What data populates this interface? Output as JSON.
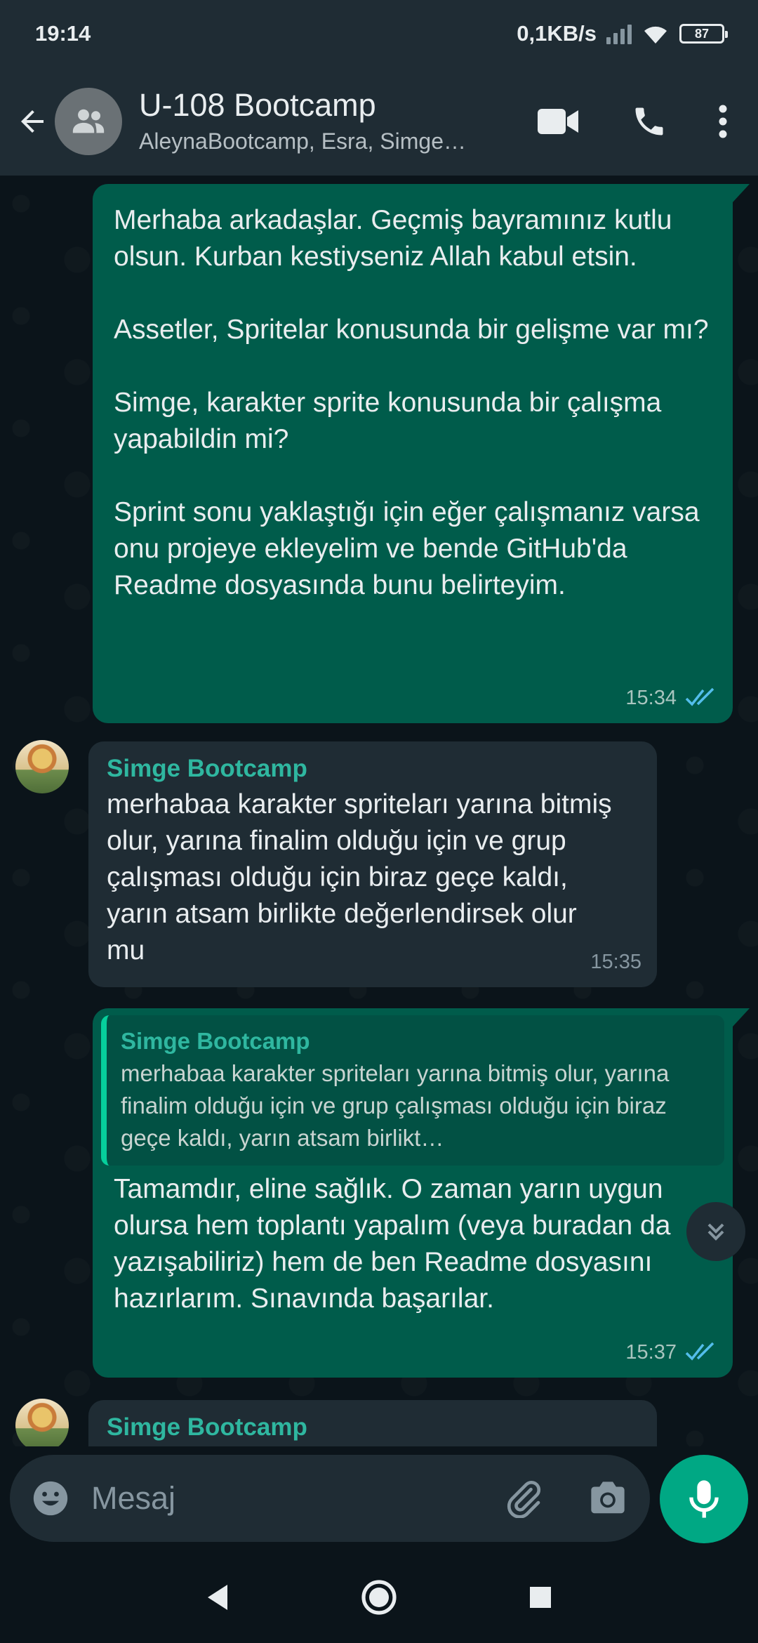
{
  "status_bar": {
    "time": "19:14",
    "network_speed": "0,1KB/s",
    "battery_level": "87"
  },
  "header": {
    "title": "U-108 Bootcamp",
    "subtitle": "AleynaBootcamp, Esra, Simge…"
  },
  "messages": [
    {
      "direction": "outgoing",
      "text": "Merhaba arkadaşlar. Geçmiş bayramınız kutlu olsun. Kurban kestiyseniz Allah kabul etsin.\n\nAssetler, Spritelar konusunda bir gelişme var mı?\n\nSimge, karakter sprite konusunda bir çalışma yapabildin mi?\n\nSprint sonu yaklaştığı için eğer çalışmanız varsa onu projeye ekleyelim ve bende GitHub'da Readme dosyasında bunu belirteyim.",
      "time": "15:34",
      "status": "read"
    },
    {
      "direction": "incoming",
      "sender": "Simge Bootcamp",
      "text": "merhabaa karakter spriteları yarına bitmiş olur, yarına finalim olduğu için ve grup çalışması olduğu için biraz geçe kaldı,  yarın atsam birlikte değerlendirsek olur mu",
      "time": "15:35"
    },
    {
      "direction": "outgoing",
      "quote": {
        "sender": "Simge Bootcamp",
        "text": "merhabaa karakter spriteları yarına bitmiş olur, yarına finalim olduğu için ve grup çalışması olduğu için biraz geçe kaldı,  yarın atsam birlikt…"
      },
      "text": "Tamamdır, eline sağlık. O zaman yarın uygun olursa hem toplantı yapalım (veya buradan da yazışabiliriz) hem de ben Readme dosyasını hazırlarım. Sınavında başarılar.",
      "time": "15:37",
      "status": "read"
    },
    {
      "direction": "incoming",
      "sender": "Simge Bootcamp"
    }
  ],
  "composer": {
    "placeholder": "Mesaj"
  },
  "colors": {
    "outgoing_bubble": "#005c4b",
    "incoming_bubble": "#1f2c34",
    "accent": "#00a884",
    "read_ticks": "#53bdeb",
    "sender_name": "#2fb7a0"
  },
  "icons": {
    "back": "arrow-left-icon",
    "group_avatar": "group-icon",
    "video": "video-camera-icon",
    "call": "phone-icon",
    "menu": "more-vertical-icon",
    "emoji": "emoji-icon",
    "attach": "paperclip-icon",
    "camera": "camera-icon",
    "mic": "microphone-icon",
    "scroll": "chevrons-down-icon"
  }
}
